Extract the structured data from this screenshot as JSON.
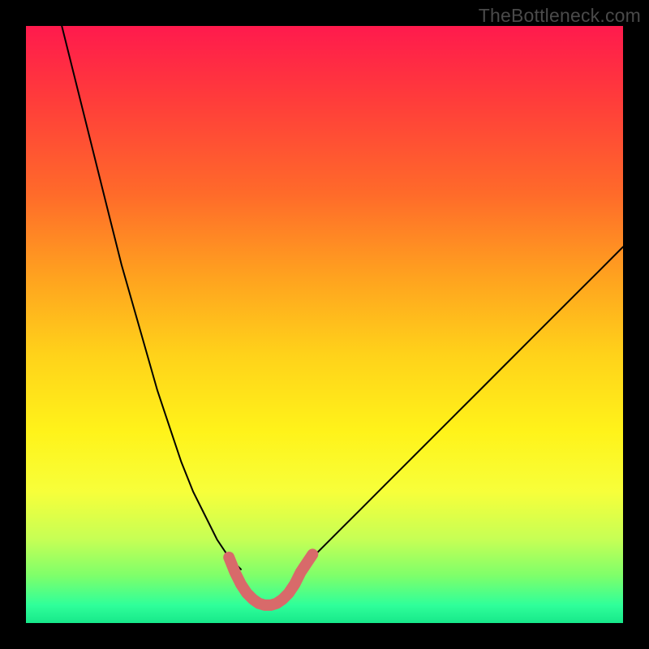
{
  "watermark": {
    "text": "TheBottleneck.com"
  },
  "chart_data": {
    "type": "line",
    "title": "",
    "xlabel": "",
    "ylabel": "",
    "xlim": [
      0,
      100
    ],
    "ylim": [
      0,
      100
    ],
    "grid": false,
    "legend": false,
    "background_gradient": {
      "top_color": "#ff1a4d",
      "bottom_color": "#17e88a",
      "description": "Vertical gradient from red (top, worst) through orange, yellow to green (bottom, best)"
    },
    "series": [
      {
        "name": "left-curve-black",
        "color": "#000000",
        "width": 2,
        "x": [
          6,
          8,
          10,
          12,
          14,
          16,
          18,
          20,
          22,
          24,
          26,
          28,
          30,
          32,
          34,
          36
        ],
        "y": [
          100,
          92,
          84,
          76,
          68,
          60,
          53,
          46,
          39,
          33,
          27,
          22,
          18,
          14,
          11,
          9
        ]
      },
      {
        "name": "right-curve-black",
        "color": "#000000",
        "width": 2,
        "x": [
          46,
          48,
          50,
          53,
          56,
          60,
          64,
          68,
          72,
          76,
          80,
          84,
          88,
          92,
          96,
          100
        ],
        "y": [
          9,
          11,
          13,
          16,
          19,
          23,
          27,
          31,
          35,
          39,
          43,
          47,
          51,
          55,
          59,
          63
        ]
      },
      {
        "name": "sweet-spot-pink",
        "color": "#d86a6a",
        "width": 8,
        "x": [
          34,
          35,
          36,
          37,
          38,
          39,
          40,
          41,
          42,
          43,
          44,
          45,
          46,
          47,
          48
        ],
        "y": [
          11,
          8.5,
          6.5,
          5,
          4,
          3.3,
          3,
          3,
          3.3,
          4,
          5,
          6.5,
          8.5,
          10,
          11.5
        ]
      }
    ],
    "annotations": []
  }
}
